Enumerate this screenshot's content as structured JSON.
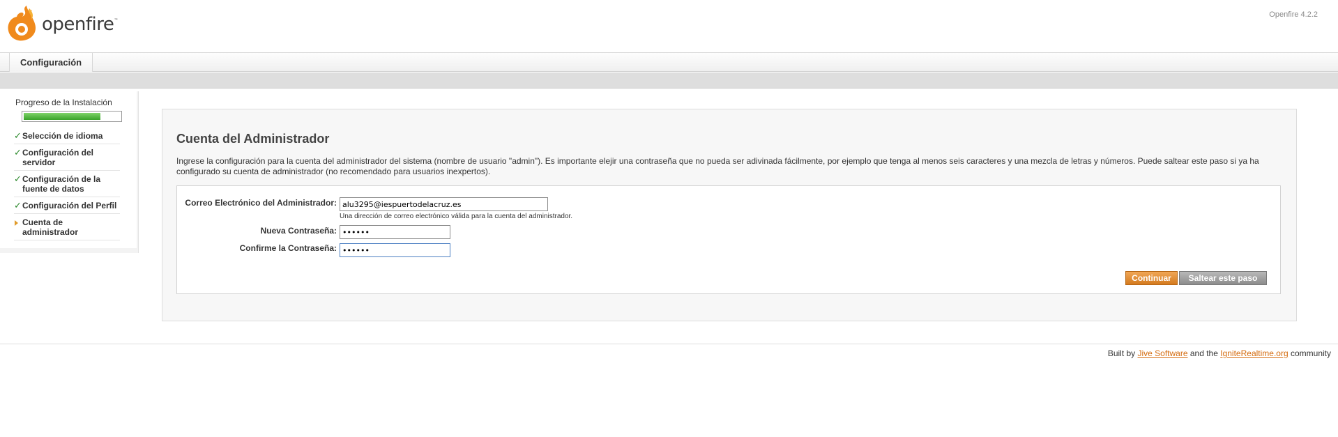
{
  "header": {
    "logo_text": "openfire",
    "logo_tm": "™",
    "version": "Openfire 4.2.2"
  },
  "tabs": [
    {
      "label": "Configuración"
    }
  ],
  "sidebar": {
    "progress_title": "Progreso de la Instalación",
    "progress_fraction": 0.8,
    "steps": [
      {
        "label": "Selección de idioma",
        "status": "done"
      },
      {
        "label": "Configuración del servidor",
        "status": "done"
      },
      {
        "label": "Configuración de la fuente de datos",
        "status": "done"
      },
      {
        "label": "Configuración del Perfil",
        "status": "done"
      },
      {
        "label": "Cuenta de administrador",
        "status": "current"
      }
    ],
    "done_mark": "✓"
  },
  "main": {
    "title": "Cuenta del Administrador",
    "description": "Ingrese la configuración para la cuenta del administrador del sistema (nombre de usuario \"admin\"). Es importante elejir una contraseña que no pueda ser adivinada fácilmente, por ejemplo que tenga al menos seis caracteres y una mezcla de letras y números. Puede saltear este paso si ya ha configurado su cuenta de administrador (no recomendado para usuarios inexpertos).",
    "form": {
      "email_label": "Correo Electrónico del Administrador:",
      "email_value": "alu3295@iespuertodelacruz.es",
      "email_hint": "Una dirección de correo electrónico válida para la cuenta del administrador.",
      "password_label": "Nueva Contraseña:",
      "password_value": "••••••",
      "confirm_label": "Confirme la Contraseña:",
      "confirm_value": "••••••"
    },
    "buttons": {
      "continue": "Continuar",
      "skip": "Saltear este paso"
    }
  },
  "footer": {
    "prefix": "Built by ",
    "link1": "Jive Software",
    "middle": " and the ",
    "link2": "IgniteRealtime.org",
    "suffix": " community"
  },
  "colors": {
    "accent": "#d46b0e",
    "progress": "#3aa32a",
    "check": "#2d8a2d"
  }
}
